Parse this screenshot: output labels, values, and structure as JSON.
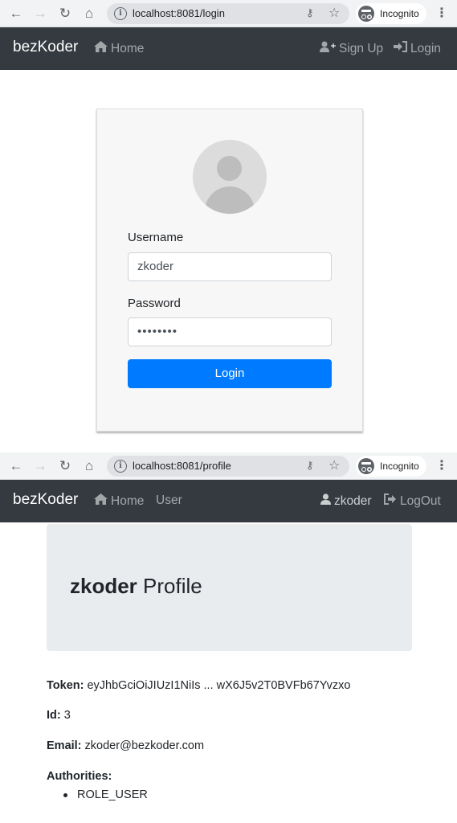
{
  "login_window": {
    "browser": {
      "url": "localhost:8081/login",
      "incognito_label": "Incognito"
    },
    "navbar": {
      "brand": "bezKoder",
      "home": "Home",
      "sign_up": "Sign Up",
      "login": "Login"
    },
    "form": {
      "username_label": "Username",
      "username_value": "zkoder",
      "password_label": "Password",
      "password_value": "••••••••",
      "submit_label": "Login"
    }
  },
  "profile_window": {
    "browser": {
      "url": "localhost:8081/profile",
      "incognito_label": "Incognito"
    },
    "navbar": {
      "brand": "bezKoder",
      "home": "Home",
      "user": "User",
      "username": "zkoder",
      "logout": "LogOut"
    },
    "profile": {
      "title_user": "zkoder",
      "title_suffix": " Profile",
      "token_label": "Token:",
      "token_value": " eyJhbGciOiJIUzI1NiIs ... wX6J5v2T0BVFb67Yvzxo",
      "id_label": "Id:",
      "id_value": " 3",
      "email_label": "Email:",
      "email_value": " zkoder@bezkoder.com",
      "authorities_label": "Authorities:",
      "authorities": [
        "ROLE_USER"
      ]
    }
  },
  "colors": {
    "navbar_bg": "#343a40",
    "primary_button": "#007bff",
    "jumbotron_bg": "#e9ecef",
    "card_bg": "#f7f7f7"
  }
}
